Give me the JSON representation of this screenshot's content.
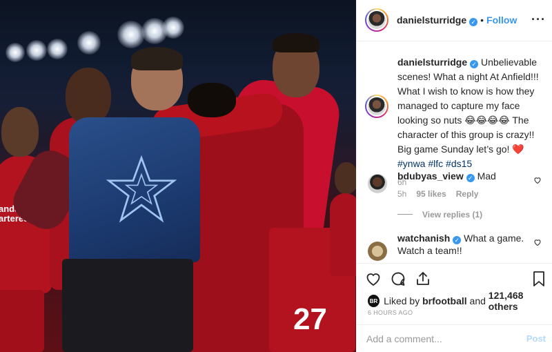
{
  "photo": {
    "sponsor_line1": "andard",
    "sponsor_line2": "artered",
    "shirt_number": "27"
  },
  "header": {
    "username": "danielsturridge",
    "separator": "•",
    "follow_label": "Follow",
    "more_icon": "more-dots-icon"
  },
  "caption": {
    "username": "danielsturridge",
    "text": "Unbelievable scenes! What a night At Anfield!!! What I wish to know is how they managed to capture my face looking so nuts 😂😂😂😂 The character of this group is crazy!! Big game Sunday let’s go! ❤️",
    "hashtags": [
      "#ynwa",
      "#lfc",
      "#ds15"
    ],
    "time": "6h"
  },
  "comments": [
    {
      "username": "bdubyas_view",
      "text": "Mad",
      "time": "5h",
      "likes": "95 likes",
      "reply_label": "Reply"
    },
    {
      "username": "watchanish",
      "text": "What a game. Watch a team!!"
    }
  ],
  "view_replies": "View replies (1)",
  "actions": {
    "like_icon": "heart-icon",
    "comment_icon": "comment-icon",
    "share_icon": "share-icon",
    "save_icon": "bookmark-icon"
  },
  "likes": {
    "badge": "BR",
    "liked_by_prefix": "Liked by ",
    "liked_by_user": "brfootball",
    "and": " and ",
    "others": "121,468 others"
  },
  "posted_time": "6 HOURS AGO",
  "add_comment": {
    "placeholder": "Add a comment...",
    "post_label": "Post"
  },
  "colors": {
    "accent": "#3897f0",
    "post_disabled": "#b3dbff",
    "liverpool_red": "#c8102e"
  }
}
